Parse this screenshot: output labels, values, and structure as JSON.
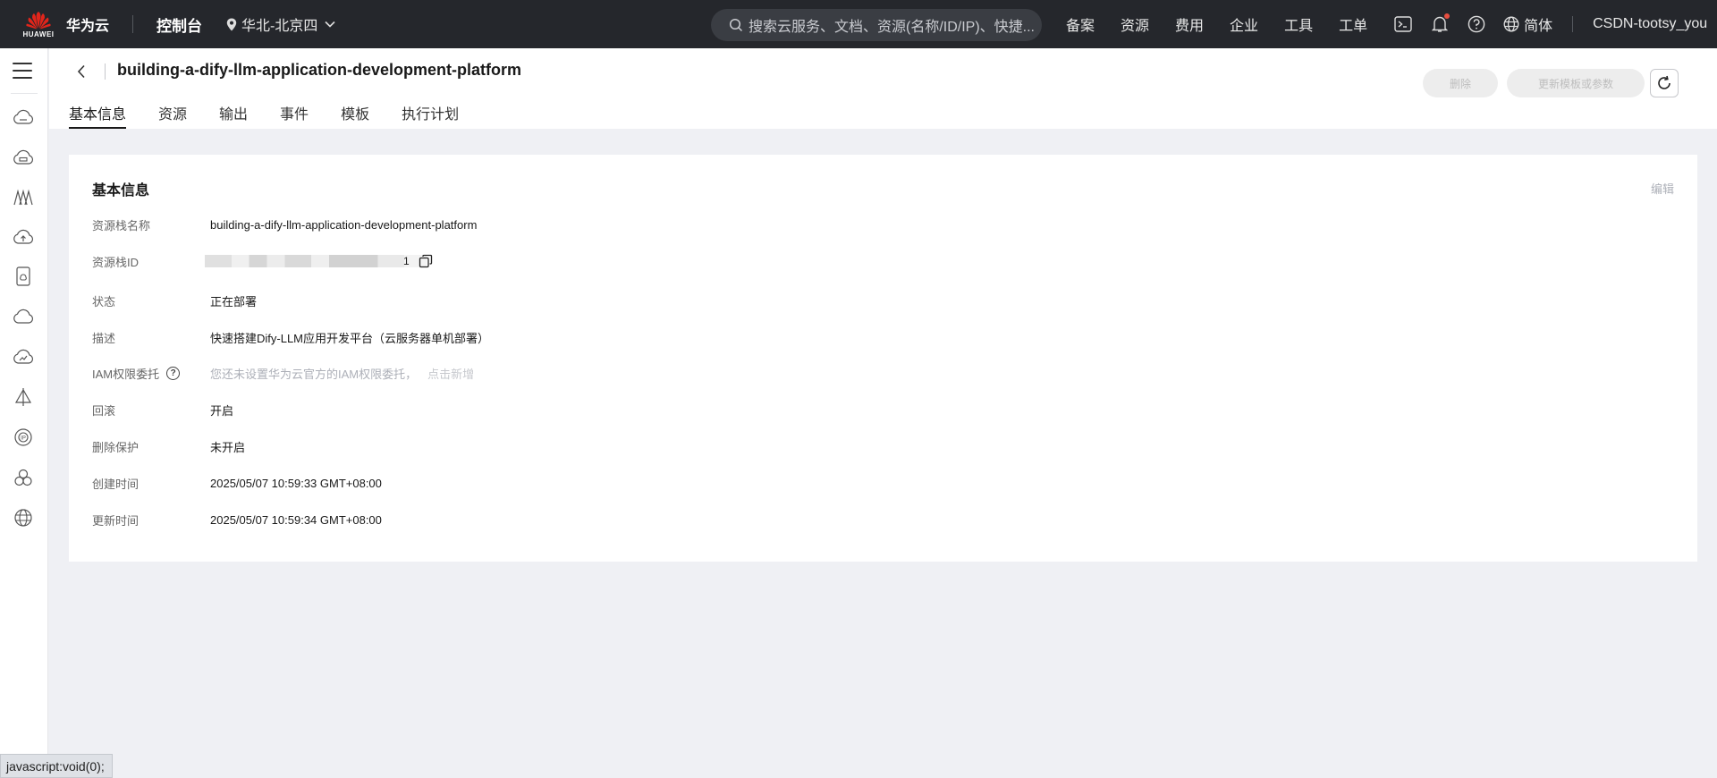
{
  "topbar": {
    "logo_text": "HUAWEI",
    "brand": "华为云",
    "console": "控制台",
    "region": "华北-北京四",
    "search_placeholder": "搜索云服务、文档、资源(名称/ID/IP)、快捷...",
    "nav": [
      "备案",
      "资源",
      "费用",
      "企业",
      "工具",
      "工单"
    ],
    "language": "简体",
    "user": "CSDN-tootsy_you"
  },
  "sidebar": {
    "icons": [
      "cloud-server-icon",
      "cloud-storage-icon",
      "network-icon",
      "cloud-upload-icon",
      "database-icon",
      "cloud-icon",
      "cloud-monitor-icon",
      "deploy-icon",
      "ip-icon",
      "cluster-icon",
      "globe-icon"
    ]
  },
  "header": {
    "title": "building-a-dify-llm-application-development-platform",
    "tabs": [
      "基本信息",
      "资源",
      "输出",
      "事件",
      "模板",
      "执行计划"
    ],
    "delete_label": "删除",
    "update_label": "更新模板或参数"
  },
  "card": {
    "title": "基本信息",
    "edit_label": "编辑",
    "fields": {
      "stack_name": {
        "label": "资源栈名称",
        "value": "building-a-dify-llm-application-development-platform"
      },
      "stack_id": {
        "label": "资源栈ID",
        "value": "1"
      },
      "status": {
        "label": "状态",
        "value": "正在部署"
      },
      "description": {
        "label": "描述",
        "value": "快速搭建Dify-LLM应用开发平台（云服务器单机部署）"
      },
      "iam": {
        "label": "IAM权限委托",
        "value": "您还未设置华为云官方的IAM权限委托，",
        "link": "点击新增"
      },
      "rollback": {
        "label": "回滚",
        "value": "开启"
      },
      "delete_protection": {
        "label": "删除保护",
        "value": "未开启"
      },
      "created": {
        "label": "创建时间",
        "value": "2025/05/07 10:59:33 GMT+08:00"
      },
      "updated": {
        "label": "更新时间",
        "value": "2025/05/07 10:59:34 GMT+08:00"
      }
    }
  },
  "statusbar": {
    "text": "javascript:void(0);"
  },
  "colors": {
    "topbar_bg": "#25272c",
    "page_bg": "#eff0f4",
    "accent_red": "#e84e40"
  }
}
